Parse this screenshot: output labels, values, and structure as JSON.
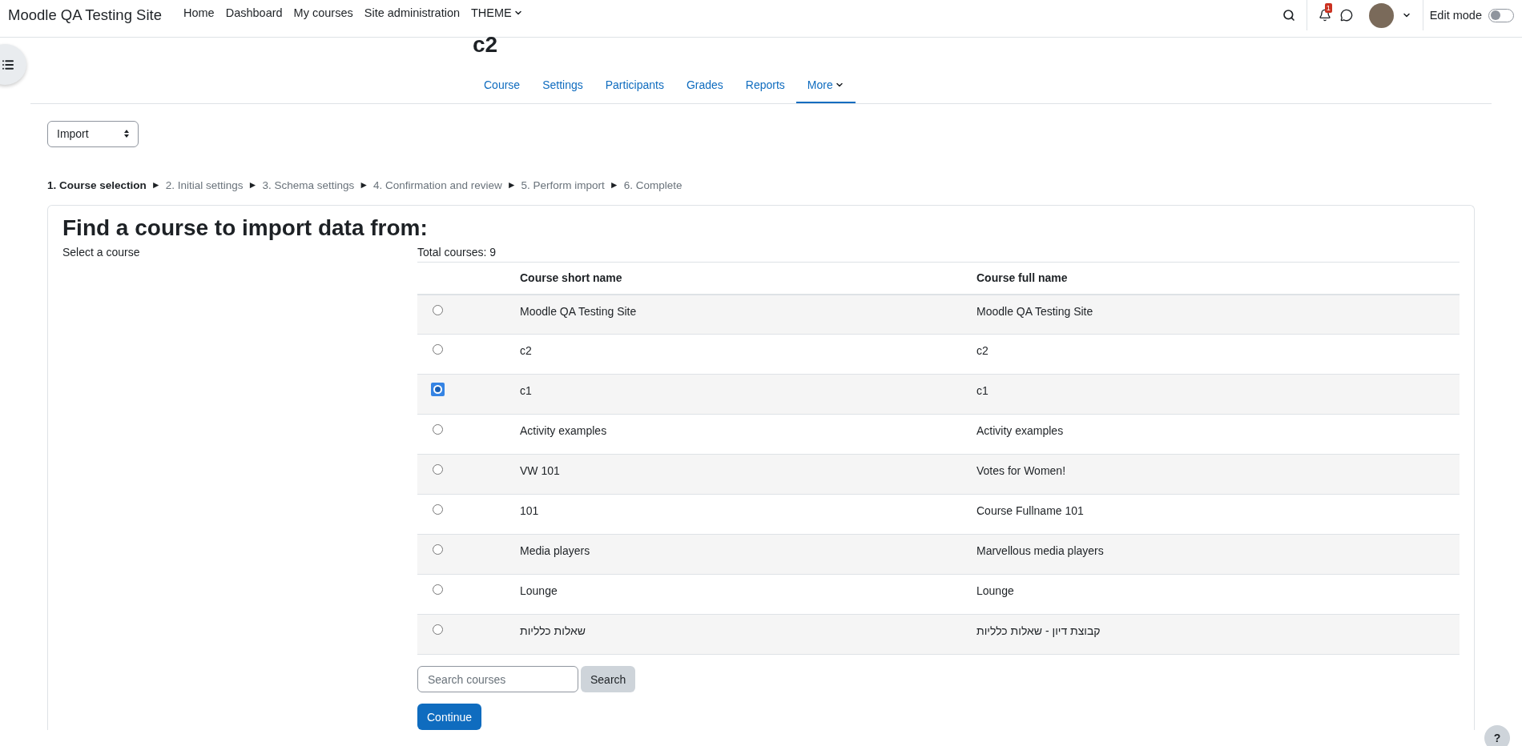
{
  "navbar": {
    "site_name": "Moodle QA Testing Site",
    "links": [
      {
        "label": "Home",
        "dropdown": false
      },
      {
        "label": "Dashboard",
        "dropdown": false
      },
      {
        "label": "My courses",
        "dropdown": false
      },
      {
        "label": "Site administration",
        "dropdown": false
      },
      {
        "label": "THEME",
        "dropdown": true
      }
    ],
    "notification_count": "1",
    "edit_mode": {
      "label": "Edit mode",
      "on": false
    }
  },
  "page_title": "c2",
  "secondary_nav": [
    {
      "label": "Course",
      "selected": false,
      "dropdown": false
    },
    {
      "label": "Settings",
      "selected": false,
      "dropdown": false
    },
    {
      "label": "Participants",
      "selected": false,
      "dropdown": false
    },
    {
      "label": "Grades",
      "selected": false,
      "dropdown": false
    },
    {
      "label": "Reports",
      "selected": false,
      "dropdown": false
    },
    {
      "label": "More",
      "selected": true,
      "dropdown": true
    }
  ],
  "action_select": "Import",
  "steps": [
    {
      "label": "1. Course selection",
      "selected": true
    },
    {
      "separator": "►",
      "label": "2. Initial settings",
      "selected": false
    },
    {
      "separator": "►",
      "label": "3. Schema settings",
      "selected": false
    },
    {
      "separator": "►",
      "label": "4. Confirmation and review",
      "selected": false
    },
    {
      "separator": "►",
      "label": "5. Perform import",
      "selected": false
    },
    {
      "separator": "►",
      "label": "6. Complete",
      "selected": false
    }
  ],
  "card": {
    "heading": "Find a course to import data from:",
    "select_label": "Select a course",
    "total": "Total courses: 9",
    "columns": [
      "Course short name",
      "Course full name"
    ],
    "rows": [
      {
        "short": "Moodle QA Testing Site",
        "full": "Moodle QA Testing Site",
        "selected": false
      },
      {
        "short": "c2",
        "full": "c2",
        "selected": false
      },
      {
        "short": "c1",
        "full": "c1",
        "selected": true
      },
      {
        "short": "Activity examples",
        "full": "Activity examples",
        "selected": false
      },
      {
        "short": "VW 101",
        "full": "Votes for Women!",
        "selected": false
      },
      {
        "short": "101",
        "full": "Course Fullname 101",
        "selected": false
      },
      {
        "short": "Media players",
        "full": "Marvellous media players",
        "selected": false
      },
      {
        "short": "Lounge",
        "full": "Lounge",
        "selected": false
      },
      {
        "short": "שאלות כלליות",
        "full": "קבוצת דיון - שאלות כלליות",
        "selected": false
      }
    ],
    "search_placeholder": "Search courses",
    "search_button": "Search",
    "continue_button": "Continue"
  },
  "help_button": "?"
}
